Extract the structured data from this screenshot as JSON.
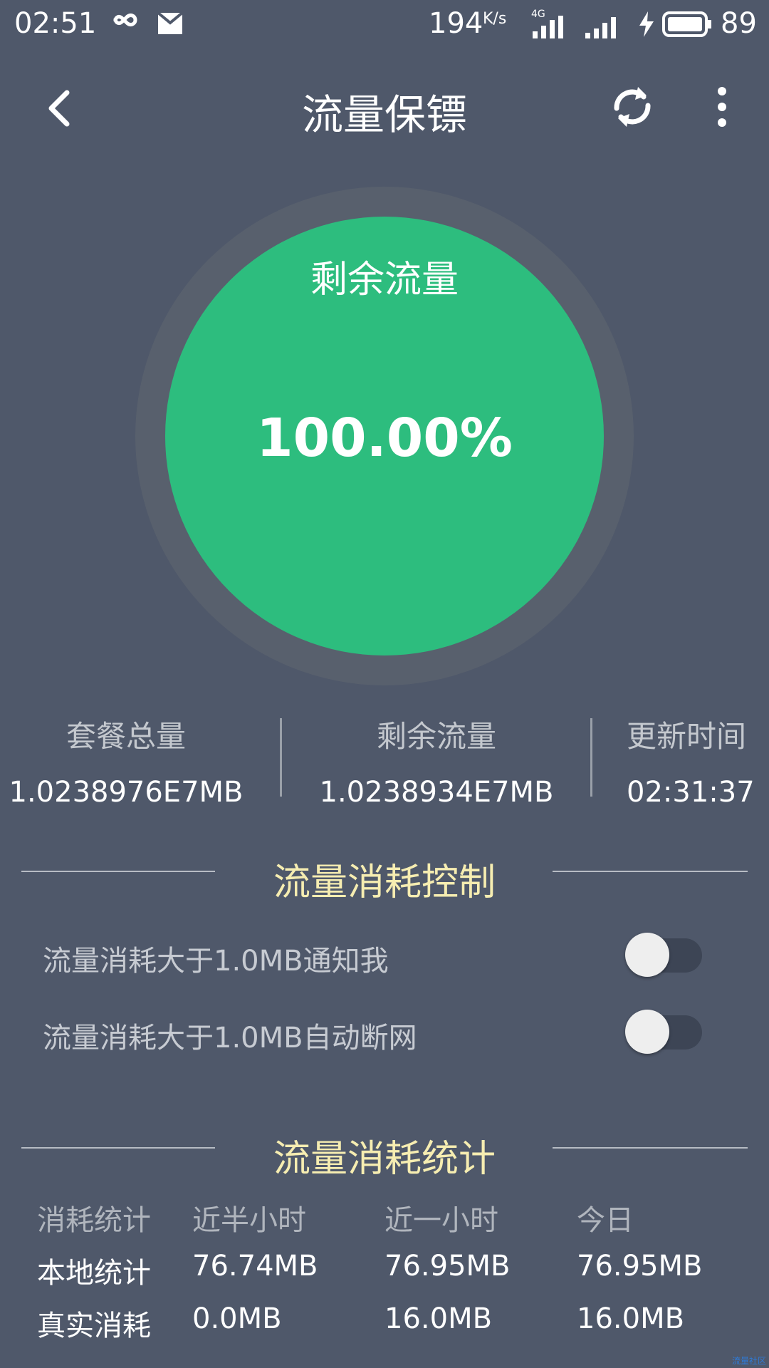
{
  "status_bar": {
    "time": "02:51",
    "speed": "194",
    "speed_unit": "K/s",
    "network": "4G",
    "battery": "89"
  },
  "app_bar": {
    "title": "流量保镖",
    "icons": [
      "back-icon",
      "refresh-icon",
      "more-icon"
    ]
  },
  "gauge": {
    "label": "剩余流量",
    "value": "100.00%",
    "fill_fraction": 1.0,
    "color": "#2dbd7e"
  },
  "stats": [
    {
      "label": "套餐总量",
      "value": "1.0238976E7MB"
    },
    {
      "label": "剩余流量",
      "value": "1.0238934E7MB"
    },
    {
      "label": "更新时间",
      "value": "02:31:37"
    }
  ],
  "control": {
    "title": "流量消耗控制",
    "items": [
      {
        "label": "流量消耗大于1.0MB通知我",
        "enabled": false
      },
      {
        "label": "流量消耗大于1.0MB自动断网",
        "enabled": false
      }
    ]
  },
  "statistics": {
    "title": "流量消耗统计",
    "headers": [
      "消耗统计",
      "近半小时",
      "近一小时",
      "今日"
    ],
    "rows": [
      [
        "本地统计",
        "76.74MB",
        "76.95MB",
        "76.95MB"
      ],
      [
        "真实消耗",
        "0.0MB",
        "16.0MB",
        "16.0MB"
      ]
    ]
  },
  "watermark": "流量社区",
  "colors": {
    "background": "#4f586a",
    "accent_green": "#2dbd7e",
    "section_title": "#f6edb1"
  }
}
